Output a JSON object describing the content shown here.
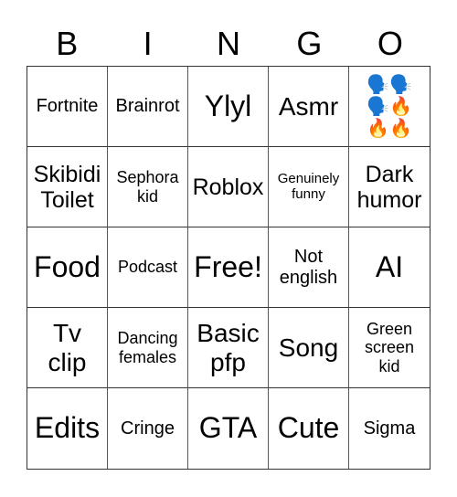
{
  "header": [
    "B",
    "I",
    "N",
    "G",
    "O"
  ],
  "cells": [
    {
      "text": "Fortnite",
      "size": "s-s"
    },
    {
      "text": "Brainrot",
      "size": "s-s"
    },
    {
      "text": "Ylyl",
      "size": "s-xl"
    },
    {
      "text": "Asmr",
      "size": "s-l"
    },
    {
      "text": "🗣️🗣️\n🗣️🔥\n🔥🔥",
      "size": "emoji"
    },
    {
      "text": "Skibidi\nToilet",
      "size": "s-m"
    },
    {
      "text": "Sephora\nkid",
      "size": "s-xs"
    },
    {
      "text": "Roblox",
      "size": "s-m"
    },
    {
      "text": "Genuinely\nfunny",
      "size": "s-xxs"
    },
    {
      "text": "Dark\nhumor",
      "size": "s-m"
    },
    {
      "text": "Food",
      "size": "s-xl"
    },
    {
      "text": "Podcast",
      "size": "s-xs"
    },
    {
      "text": "Free!",
      "size": "s-xl"
    },
    {
      "text": "Not\nenglish",
      "size": "s-s"
    },
    {
      "text": "AI",
      "size": "s-xl"
    },
    {
      "text": "Tv\nclip",
      "size": "s-l"
    },
    {
      "text": "Dancing\nfemales",
      "size": "s-xs"
    },
    {
      "text": "Basic\npfp",
      "size": "s-l"
    },
    {
      "text": "Song",
      "size": "s-l"
    },
    {
      "text": "Green\nscreen\nkid",
      "size": "s-xs"
    },
    {
      "text": "Edits",
      "size": "s-xl"
    },
    {
      "text": "Cringe",
      "size": "s-s"
    },
    {
      "text": "GTA",
      "size": "s-xl"
    },
    {
      "text": "Cute",
      "size": "s-xl"
    },
    {
      "text": "Sigma",
      "size": "s-s"
    }
  ]
}
